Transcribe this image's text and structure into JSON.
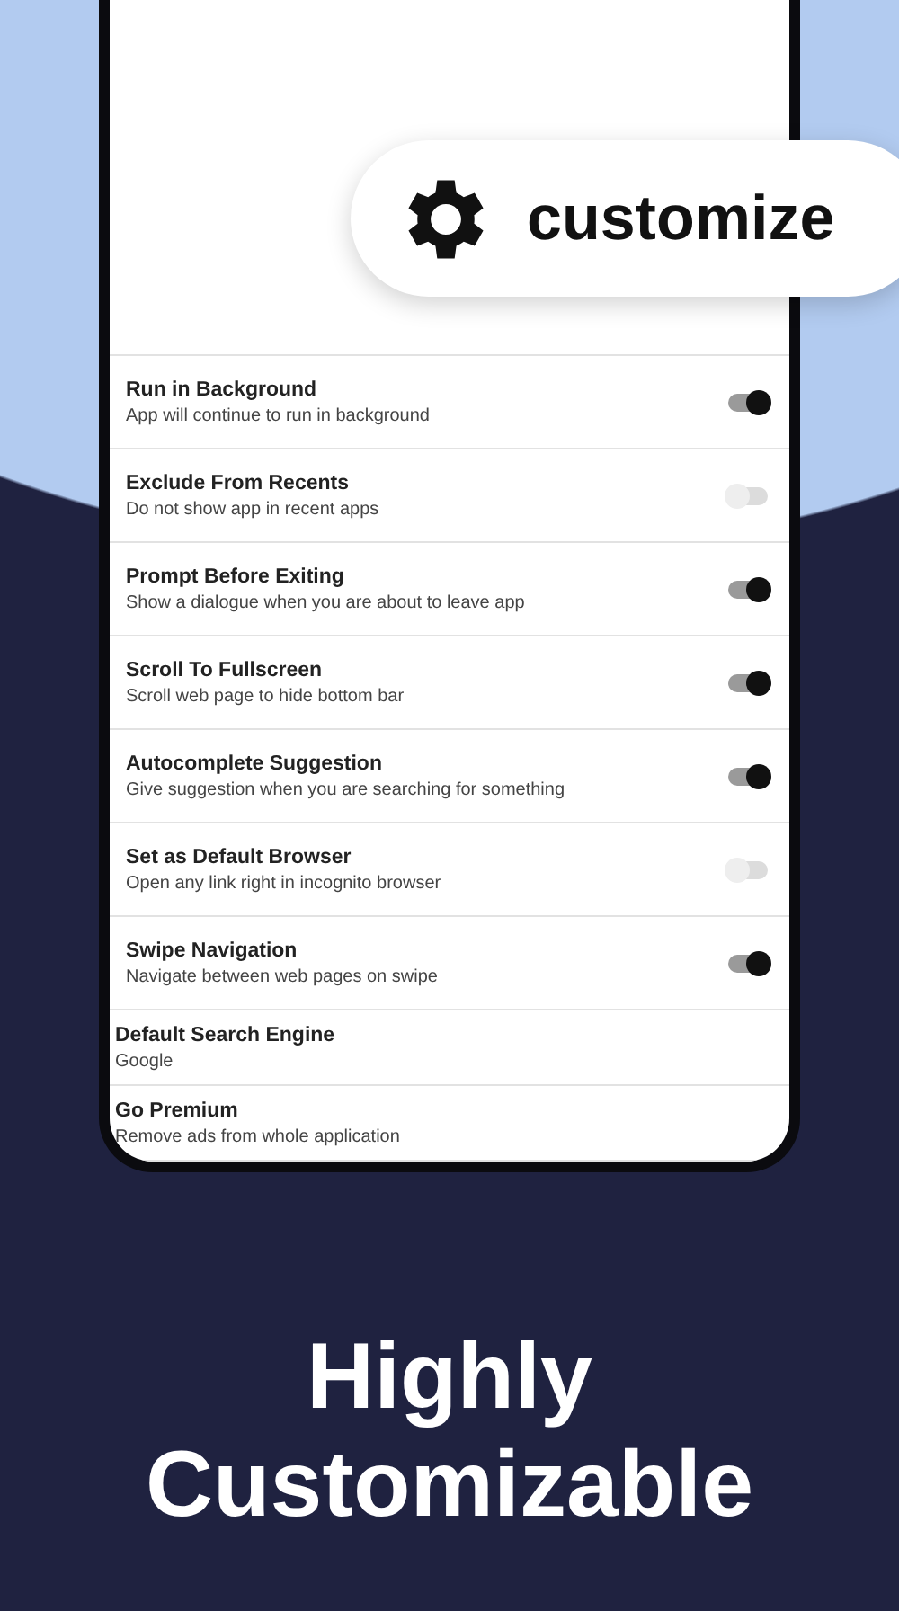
{
  "badge": {
    "label": "customize"
  },
  "settings": [
    {
      "kind": "toggle",
      "title": "Run in Background",
      "subtitle": "App will continue to run in background",
      "on": true
    },
    {
      "kind": "toggle",
      "title": "Exclude From Recents",
      "subtitle": "Do not show app in recent apps",
      "on": false
    },
    {
      "kind": "toggle",
      "title": "Prompt Before Exiting",
      "subtitle": "Show a dialogue when you are about to leave app",
      "on": true
    },
    {
      "kind": "toggle",
      "title": "Scroll To Fullscreen",
      "subtitle": "Scroll web page to hide bottom bar",
      "on": true
    },
    {
      "kind": "toggle",
      "title": "Autocomplete Suggestion",
      "subtitle": "Give suggestion when you are searching for something",
      "on": true
    },
    {
      "kind": "toggle",
      "title": "Set as Default Browser",
      "subtitle": "Open any link right in incognito browser",
      "on": false
    },
    {
      "kind": "toggle",
      "title": "Swipe Navigation",
      "subtitle": "Navigate between web pages on swipe",
      "on": true
    },
    {
      "kind": "value",
      "title": "Default Search Engine",
      "value": "Google"
    },
    {
      "kind": "value",
      "title": "Go Premium",
      "value": "Remove ads from whole application"
    }
  ],
  "headline": "Highly Customizable"
}
